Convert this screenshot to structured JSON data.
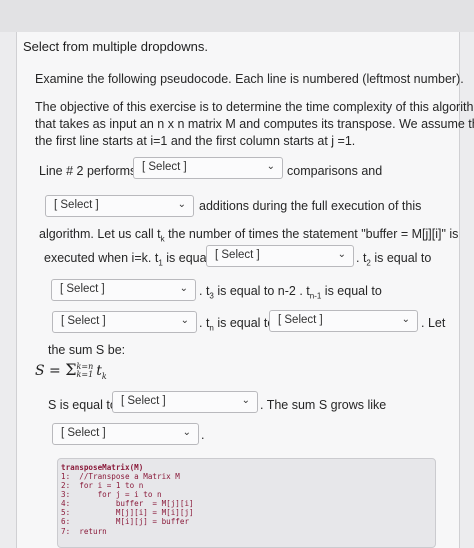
{
  "header": "Select from multiple dropdowns.",
  "intro": {
    "line1": "Examine the following pseudocode. Each line is numbered (leftmost number).",
    "line2": "The objective of this exercise is to determine the time complexity of this algorithm",
    "line3": "that takes as input an n x n matrix M  and computes its transpose. We assume that",
    "line4": "the first line starts at i=1 and the first column starts at j =1."
  },
  "q": {
    "line2_performs": "Line # 2 performs",
    "comparisons_and": "comparisons and",
    "additions": "additions during the full execution of this",
    "algorithm": "algorithm. Let us call t",
    "algorithm_sub": "k",
    "algorithm_rest": " the number of times the statement \"buffer = M[j][i]\" is",
    "executed": "executed when i=k. t",
    "executed_sub": "1",
    "executed_rest": " is equal to",
    "t2": ". t",
    "t2_sub": "2",
    "t2_rest": " is equal to",
    "t3": ". t",
    "t3_sub": "3",
    "t3_rest": " is equal to n-2 . t",
    "tn1_sub": "n-1",
    "tn1_rest": " is equal to",
    "tn": ". t",
    "tn_sub": "n",
    "tn_rest": " is equal to",
    "let": ". Let",
    "sum_be": "the sum S be:",
    "s_equal": "S is equal to",
    "grows": ". The sum S grows like",
    "period": "."
  },
  "select_label": "[ Select ]",
  "chevron": "⌄",
  "formula": {
    "lhs": "S",
    "eq": " = ",
    "sigma": "Σ",
    "upper": "k=n",
    "lower": "k=1",
    "term": "t",
    "term_sub": "k"
  },
  "code": [
    "transposeMatrix(M)",
    "1:  //Transpose a Matrix M",
    "2:  for i = 1 to n",
    "3:      for j = i to n",
    "4:          buffer  = M[j][i]",
    "5:          M[j][i] = M[i][j]",
    "6:          M[i][j] = buffer",
    "7:  return"
  ]
}
